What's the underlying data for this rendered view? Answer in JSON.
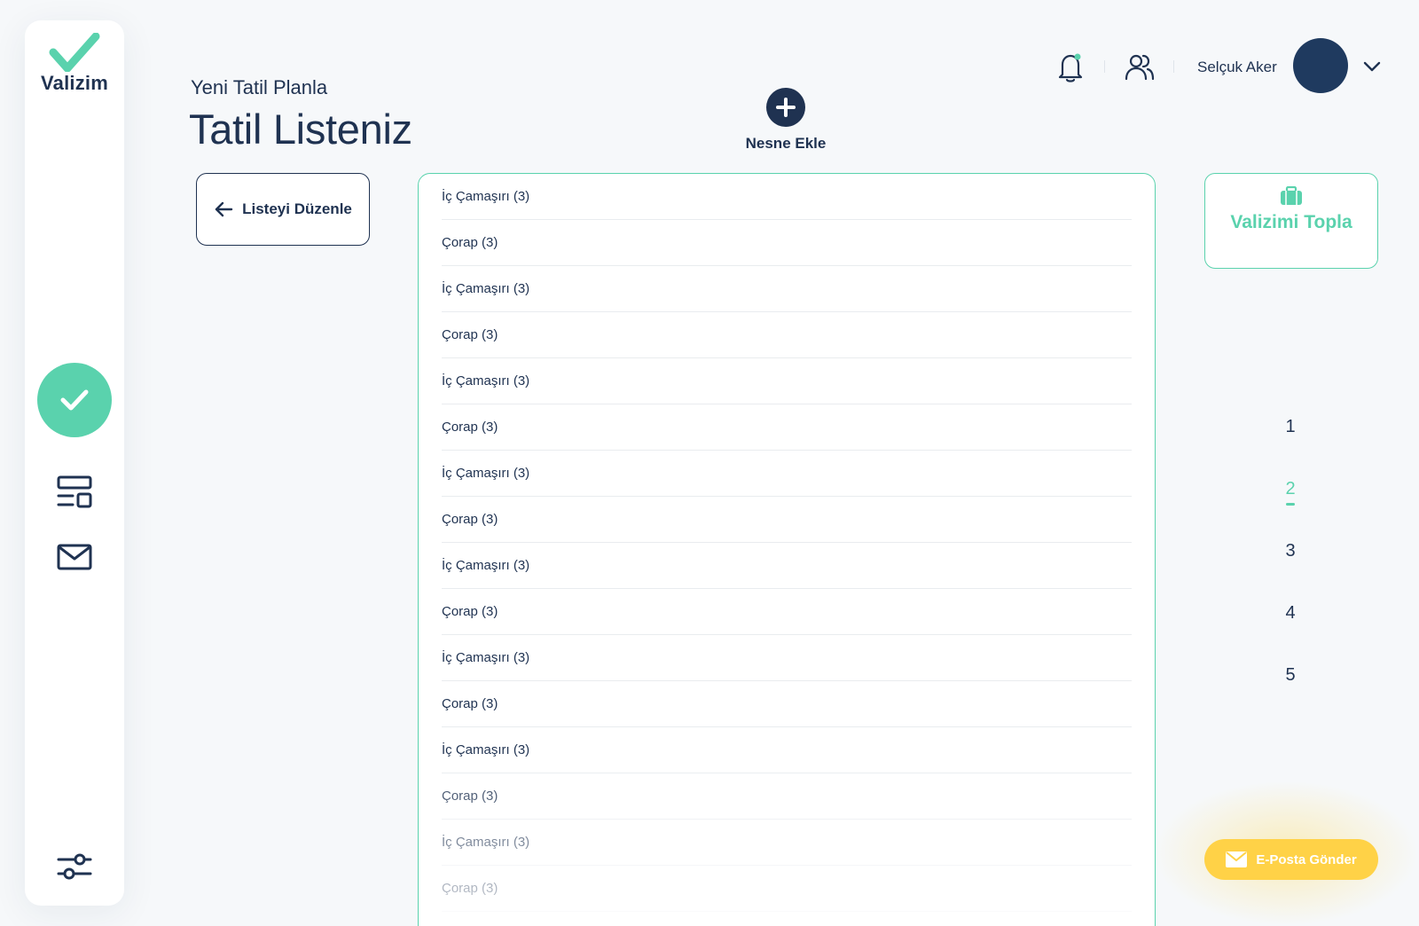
{
  "brand": {
    "name": "Valizim",
    "accent_color": "#5ad2ad",
    "primary_color": "#1f3251",
    "email_color": "#ffd247"
  },
  "sidebar": {
    "items": [
      {
        "name": "checklist",
        "icon": "check-icon",
        "active": true
      },
      {
        "name": "layout",
        "icon": "layout-icon",
        "active": false
      },
      {
        "name": "mail",
        "icon": "mail-icon",
        "active": false
      },
      {
        "name": "settings",
        "icon": "sliders-icon",
        "active": false
      }
    ]
  },
  "header": {
    "subtitle": "Yeni Tatil Planla",
    "title": "Tatil Listeniz",
    "add_item_label": "Nesne Ekle",
    "user_name": "Selçuk Aker",
    "icons": [
      "bell-icon",
      "users-icon",
      "chevron-down-icon"
    ]
  },
  "actions": {
    "edit_list_label": "Listeyi Düzenle",
    "pack_label": "Valizimi Topla",
    "email_label": "E-Posta Gönder"
  },
  "list": {
    "items": [
      "İç Çamaşırı (3)",
      "Çorap (3)",
      "İç Çamaşırı (3)",
      "Çorap (3)",
      "İç Çamaşırı (3)",
      "Çorap (3)",
      "İç Çamaşırı (3)",
      "Çorap (3)",
      "İç Çamaşırı (3)",
      "Çorap (3)",
      "İç Çamaşırı (3)",
      "Çorap (3)",
      "İç Çamaşırı (3)",
      "Çorap (3)",
      "İç Çamaşırı (3)",
      "Çorap (3)"
    ]
  },
  "pagination": {
    "pages": [
      "1",
      "2",
      "3",
      "4",
      "5"
    ],
    "active": "2"
  }
}
